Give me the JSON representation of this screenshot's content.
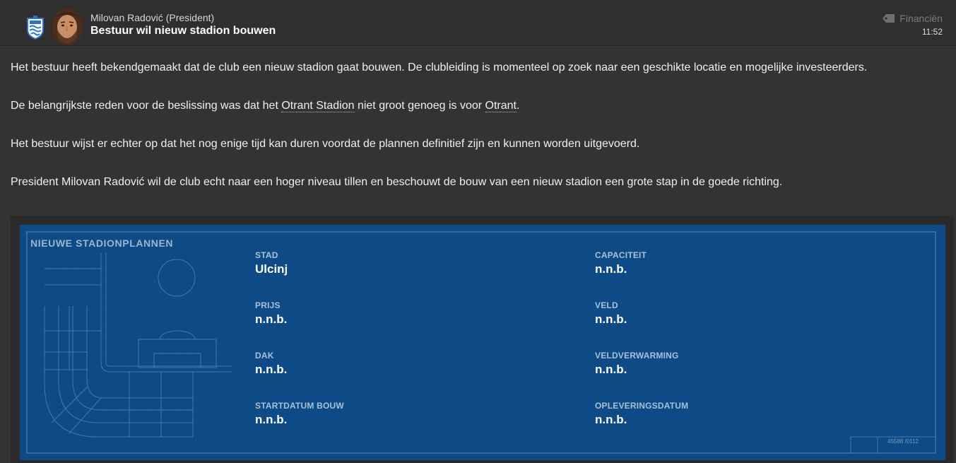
{
  "header": {
    "sender_name": "Milovan Radović",
    "sender_role": "(President)",
    "subject": "Bestuur wil nieuw stadion bouwen",
    "category": "Financiën",
    "time": "11:52",
    "icons": {
      "club_badge": "club-badge-icon",
      "avatar": "president-avatar",
      "category": "tag-icon"
    }
  },
  "body": {
    "p1": "Het bestuur heeft bekendgemaakt dat de club een nieuw stadion gaat bouwen. De clubleiding is momenteel op zoek naar een geschikte locatie en mogelijke investeerders.",
    "p2_before": "De belangrijkste reden voor de beslissing was dat het ",
    "p2_link1": "Otrant Stadion",
    "p2_middle": " niet groot genoeg is voor ",
    "p2_link2": "Otrant",
    "p2_after": ".",
    "p3": "Het bestuur wijst er echter op dat het nog enige tijd kan duren voordat de plannen definitief zijn en kunnen worden uitgevoerd.",
    "p4": "President Milovan Radović wil de club echt naar een hoger niveau tillen en beschouwt de bouw van een nieuw stadion een grote stap in de goede richting."
  },
  "plans": {
    "title": "NIEUWE STADIONPLANNEN",
    "stamp": "45588 /0112",
    "fields": {
      "stad": {
        "label": "STAD",
        "value": "Ulcinj"
      },
      "capaciteit": {
        "label": "CAPACITEIT",
        "value": "n.n.b."
      },
      "prijs": {
        "label": "PRIJS",
        "value": "n.n.b."
      },
      "veld": {
        "label": "VELD",
        "value": "n.n.b."
      },
      "dak": {
        "label": "DAK",
        "value": "n.n.b."
      },
      "veldverwarming": {
        "label": "VELDVERWARMING",
        "value": "n.n.b."
      },
      "startdatum": {
        "label": "STARTDATUM BOUW",
        "value": "n.n.b."
      },
      "opleveringsdatum": {
        "label": "OPLEVERINGSDATUM",
        "value": "n.n.b."
      }
    }
  },
  "colors": {
    "page_bg": "#333333",
    "blueprint_bg": "#0d4a86",
    "label": "#a9c0d8"
  }
}
